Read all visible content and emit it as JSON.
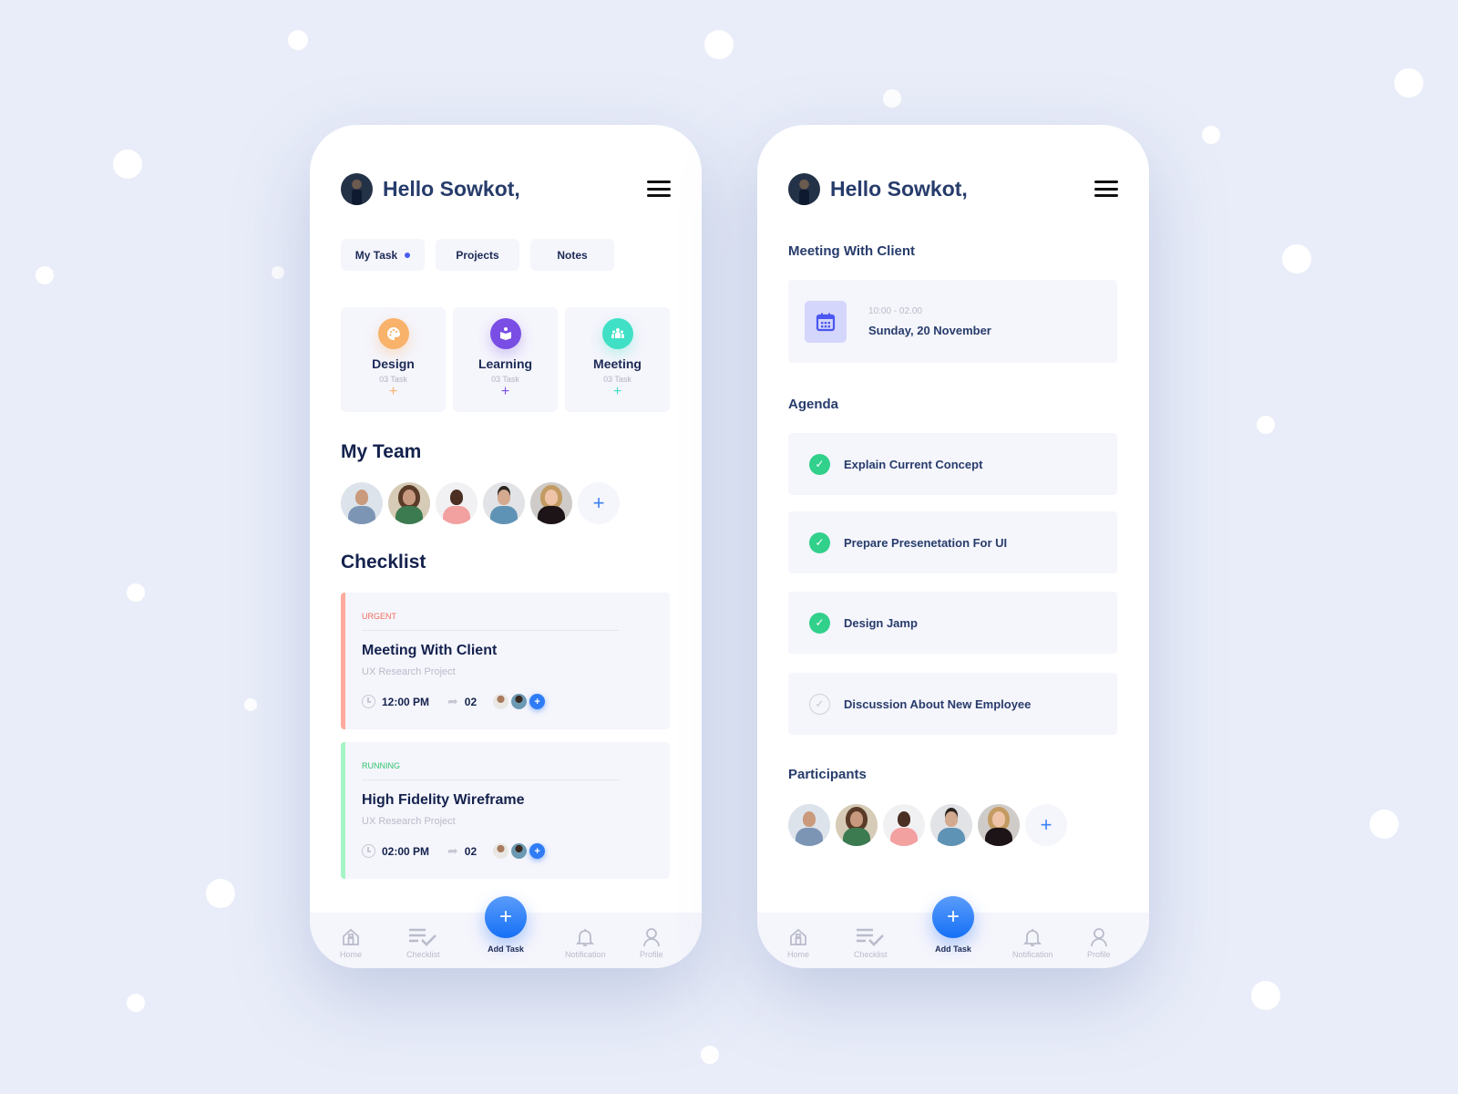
{
  "left_phone": {
    "greeting": "Hello Sowkot,",
    "tabs": [
      {
        "label": "My Task",
        "active": true
      },
      {
        "label": "Projects",
        "active": false
      },
      {
        "label": "Notes",
        "active": false
      }
    ],
    "categories": [
      {
        "name": "Design",
        "count": "03 Task",
        "icon": "palette-icon",
        "color": "#f8b26a"
      },
      {
        "name": "Learning",
        "count": "03 Task",
        "icon": "book-reader-icon",
        "color": "#7a4ee4"
      },
      {
        "name": "Meeting",
        "count": "03 Task",
        "icon": "group-icon",
        "color": "#3fe0c5"
      }
    ],
    "team_title": "My Team",
    "checklist_title": "Checklist",
    "checklist": [
      {
        "status": "URGENT",
        "status_color": "#f26e5a",
        "bar_color": "#ffaa9c",
        "title": "Meeting With Client",
        "project": "UX Research Project",
        "time": "12:00 PM",
        "shares": "02"
      },
      {
        "status": "RUNNING",
        "status_color": "#2fc36d",
        "bar_color": "#a5f5c4",
        "title": "High Fidelity Wireframe",
        "project": "UX Research Project",
        "time": "02:00 PM",
        "shares": "02"
      }
    ]
  },
  "right_phone": {
    "greeting": "Hello Sowkot,",
    "meeting_title": "Meeting With Client",
    "time_range": "10:00 - 02.00",
    "date": "Sunday, 20 November",
    "agenda_title": "Agenda",
    "agenda": [
      {
        "label": "Explain Current Concept",
        "done": true
      },
      {
        "label": "Prepare Presenetation For UI",
        "done": true
      },
      {
        "label": "Design Jamp",
        "done": true
      },
      {
        "label": "Discussion About New Employee",
        "done": false
      }
    ],
    "participants_title": "Participants"
  },
  "nav": {
    "items": [
      "Home",
      "Checklist",
      "Notification",
      "Profile"
    ],
    "add_task": "Add Task",
    "add_symbol": "+"
  },
  "icons": {
    "plus": "+",
    "check": "✓",
    "share": "➦"
  },
  "colors": {
    "accent": "#1670f6",
    "done": "#31d08b",
    "text": "#14224d",
    "bg": "#e9edf9"
  }
}
